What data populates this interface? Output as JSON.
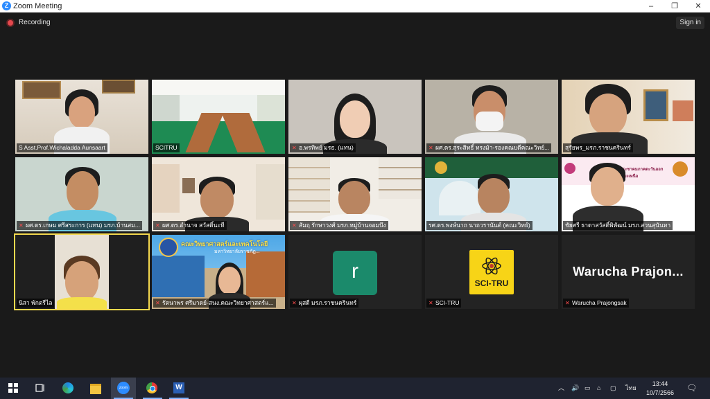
{
  "window": {
    "title": "Zoom Meeting",
    "controls": [
      "–",
      "❐",
      "✕"
    ]
  },
  "topbar": {
    "recording_label": "Recording",
    "signin_label": "Sign in"
  },
  "participants": [
    {
      "name": "S  Asst.Prof.Wichaladda Aunsaart",
      "muted": false
    },
    {
      "name": "SCITRU",
      "muted": false
    },
    {
      "name": "อ.พรทิพย์ มรธ. (แทน)",
      "muted": true
    },
    {
      "name": "ผศ.ดร.สุระสิทธิ์ ทรงม้า-รองคณบดีคณะวิทย์...",
      "muted": true
    },
    {
      "name": "สุรัยพร_มรภ.ราชนครินทร์",
      "muted": false
    },
    {
      "name": "ผศ.ดร.เกษม ศรีสระการ (แทน) มรภ.บ้านสม...",
      "muted": true
    },
    {
      "name": "ผศ.ดร.อำนาจ  สวัสดิ์นะที",
      "muted": true
    },
    {
      "name": "สัมฤ  รักษาวงศ์ มรภ.หมู่บ้านจอมบึง",
      "muted": true
    },
    {
      "name": "รศ.ดร.พงษ์นาถ นาถวรานันต์ (คณะวิทย์)",
      "muted": false
    },
    {
      "name": "ชัยศรี  ธาดาสวัสดิ์พิพัฒน์ มรภ.สวนสุนันทา",
      "muted": false
    },
    {
      "name": "นิสา พักตรีไล",
      "muted": false,
      "active_speaker": true
    },
    {
      "name": "รัตนาพร  ศรีมาดย์-สนง.คณะวิทยาศาสตร์แ...",
      "muted": true
    },
    {
      "name": "ผุสดี มรภ.ราชนครินทร์",
      "muted": true,
      "avatar_letter": "r"
    },
    {
      "name": "SCI-TRU",
      "muted": true,
      "logo_text": "SCI-TRU"
    },
    {
      "name": "Warucha Prajongsak",
      "muted": true,
      "display_text": "Warucha  Prajon..."
    }
  ],
  "banner_texts": {
    "tile12_line1": "คณะวิทยาศาสตร์และเทคโนโลยี",
    "tile12_line2": "มหาวิทยาลัยราชภัฏ...",
    "tile10_line1": "ประชาคมภาคตะวันออกเฉียงเหนือ"
  },
  "taskbar": {
    "apps": [
      "windows-start",
      "task-view",
      "edge",
      "file-explorer",
      "zoom",
      "chrome",
      "word"
    ],
    "zoom_label": "zoom",
    "word_label": "W",
    "language": "ไทย",
    "time": "13:44",
    "date": "10/7/2566"
  },
  "colors": {
    "active_speaker_border": "#f5d94e",
    "recording_dot": "#e5484d",
    "muted_icon": "#ff4d4d",
    "avatar_green": "#1b8a6b",
    "sci_logo_yellow": "#f7d417"
  }
}
